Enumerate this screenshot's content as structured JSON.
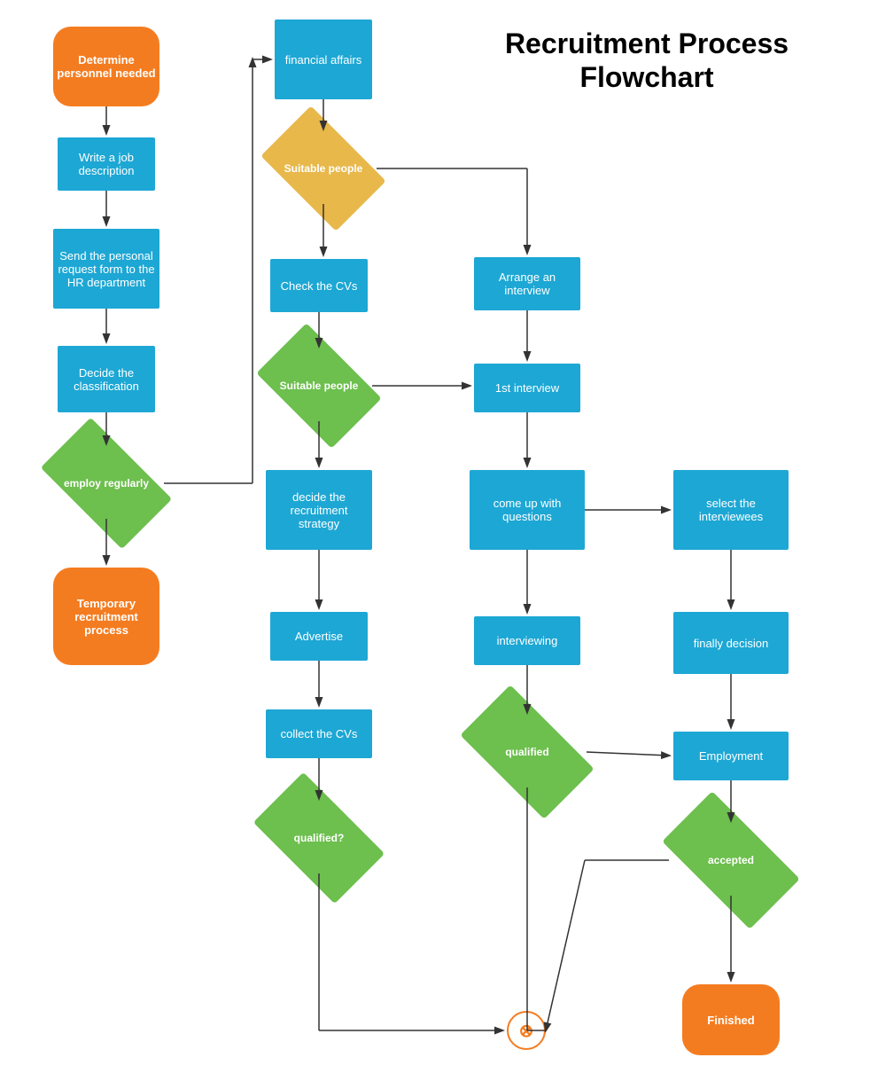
{
  "title": "Recruitment\nProcess Flowchart",
  "nodes": {
    "determine_personnel": "Determine personnel needed",
    "write_job": "Write a job description",
    "send_personal": "Send the personal request form to the HR department",
    "decide_classification": "Decide the classification",
    "employ_regularly": "employ regularly",
    "temporary_recruitment": "Temporary recruitment process",
    "financial_affairs": "financial affairs",
    "suitable_people_1": "Suitable people",
    "check_cvs": "Check the CVs",
    "suitable_people_2": "Suitable people",
    "decide_recruitment": "decide the recruitment strategy",
    "advertise": "Advertise",
    "collect_cvs": "collect the CVs",
    "qualified_q": "qualified?",
    "arrange_interview": "Arrange an interview",
    "first_interview": "1st interview",
    "come_up_questions": "come up with questions",
    "interviewing": "interviewing",
    "qualified": "qualified",
    "select_interviewees": "select the interviewees",
    "finally_decision": "finally decision",
    "employment": "Employment",
    "accepted": "accepted",
    "finished": "Finished",
    "circle_x": "⊗"
  }
}
